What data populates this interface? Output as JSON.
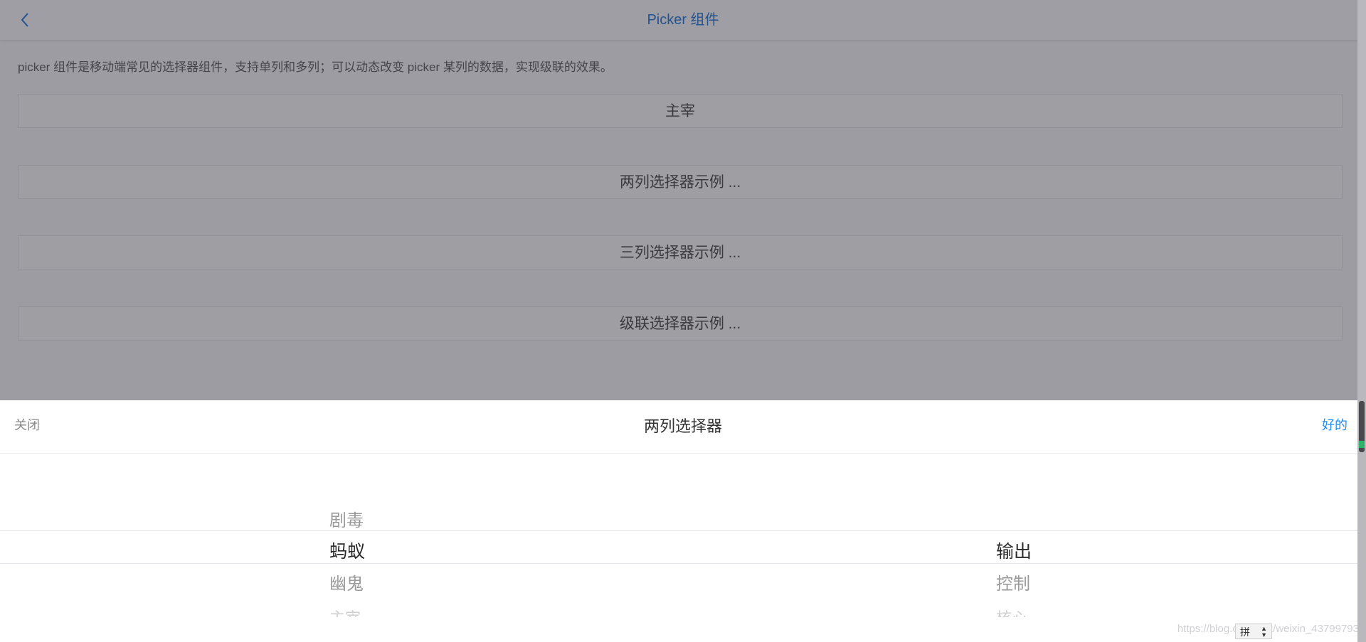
{
  "header": {
    "title": "Picker 组件"
  },
  "content": {
    "description": "picker 组件是移动端常见的选择器组件，支持单列和多列；可以动态改变 picker 某列的数据，实现级联的效果。",
    "buttons": [
      {
        "label": "主宰"
      },
      {
        "label": "两列选择器示例 ..."
      },
      {
        "label": "三列选择器示例 ..."
      },
      {
        "label": "级联选择器示例 ..."
      }
    ]
  },
  "picker": {
    "close_label": "关闭",
    "title": "两列选择器",
    "ok_label": "好的",
    "column1": [
      "剧毒",
      "蚂蚁",
      "幽鬼",
      "主宰"
    ],
    "column1_selected": "蚂蚁",
    "column2": [
      "输出",
      "控制",
      "核心"
    ],
    "column2_selected": "输出"
  },
  "ime": {
    "label": "拼"
  },
  "watermark": {
    "text": "https://blog.csdn.net/weixin_43799793"
  },
  "colors": {
    "accent": "#2f7cd6",
    "ok": "#1c8cf0"
  }
}
